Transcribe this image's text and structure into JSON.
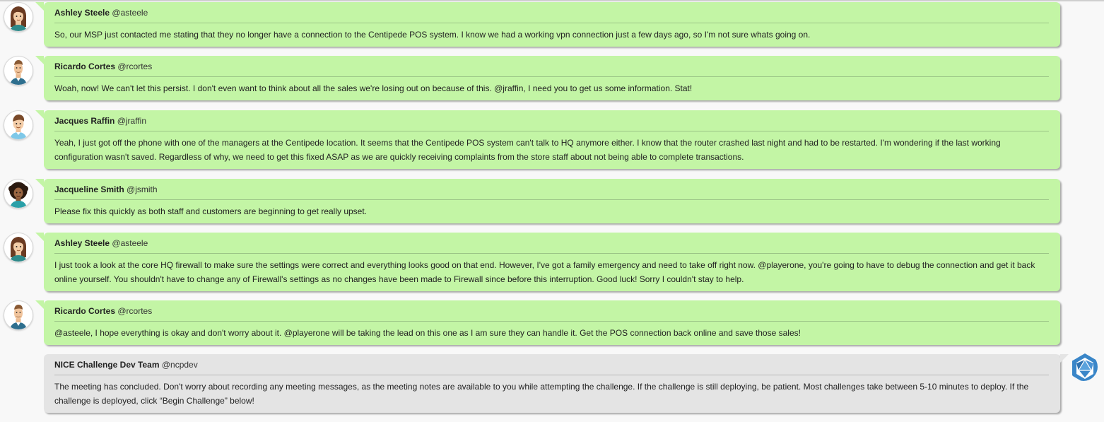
{
  "chat": {
    "messages": [
      {
        "name": "Ashley Steele",
        "handle": "@asteele",
        "text": "So, our MSP just contacted me stating that they no longer have a connection to the Centipede POS system. I know we had a working vpn connection just a few days ago, so I'm not sure whats going on.",
        "avatar": "ashley-avatar"
      },
      {
        "name": "Ricardo Cortes",
        "handle": "@rcortes",
        "text": "Woah, now! We can't let this persist. I don't even want to think about all the sales we're losing out on because of this. @jraffin, I need you to get us some information. Stat!",
        "avatar": "ricardo-avatar"
      },
      {
        "name": "Jacques Raffin",
        "handle": "@jraffin",
        "text": "Yeah, I just got off the phone with one of the managers at the Centipede location. It seems that the Centipede POS system can't talk to HQ anymore either. I know that the router crashed last night and had to be restarted. I'm wondering if the last working configuration wasn't saved. Regardless of why, we need to get this fixed ASAP as we are quickly receiving complaints from the store staff about not being able to complete transactions.",
        "avatar": "jacques-avatar"
      },
      {
        "name": "Jacqueline Smith",
        "handle": "@jsmith",
        "text": "Please fix this quickly as both staff and customers are beginning to get really upset.",
        "avatar": "jacqueline-avatar"
      },
      {
        "name": "Ashley Steele",
        "handle": "@asteele",
        "text": "I just took a look at the core HQ firewall to make sure the settings were correct and everything looks good on that end. However, I've got a family emergency and need to take off right now. @playerone, you're going to have to debug the connection and get it back online yourself. You shouldn't have to change any of Firewall's settings as no changes have been made to Firewall since before this interruption. Good luck! Sorry I couldn't stay to help.",
        "avatar": "ashley-avatar"
      },
      {
        "name": "Ricardo Cortes",
        "handle": "@rcortes",
        "text": "@asteele, I hope everything is okay and don't worry about it. @playerone will be taking the lead on this one as I am sure they can handle it. Get the POS connection back online and save those sales!",
        "avatar": "ricardo-avatar"
      },
      {
        "name": "NICE Challenge Dev Team",
        "handle": "@ncpdev",
        "text": "The meeting has concluded. Don't worry about recording any meeting messages, as the meeting notes are available to you while attempting the challenge. If the challenge is still deploying, be patient. Most challenges take between 5-10 minutes to deploy. If the challenge is deployed, click “Begin Challenge” below!",
        "avatar": "nice-logo-icon"
      }
    ]
  },
  "colors": {
    "user_bubble": "#c3f5a5",
    "system_bubble": "#e4e4e4",
    "logo_blue": "#3a86c8"
  }
}
